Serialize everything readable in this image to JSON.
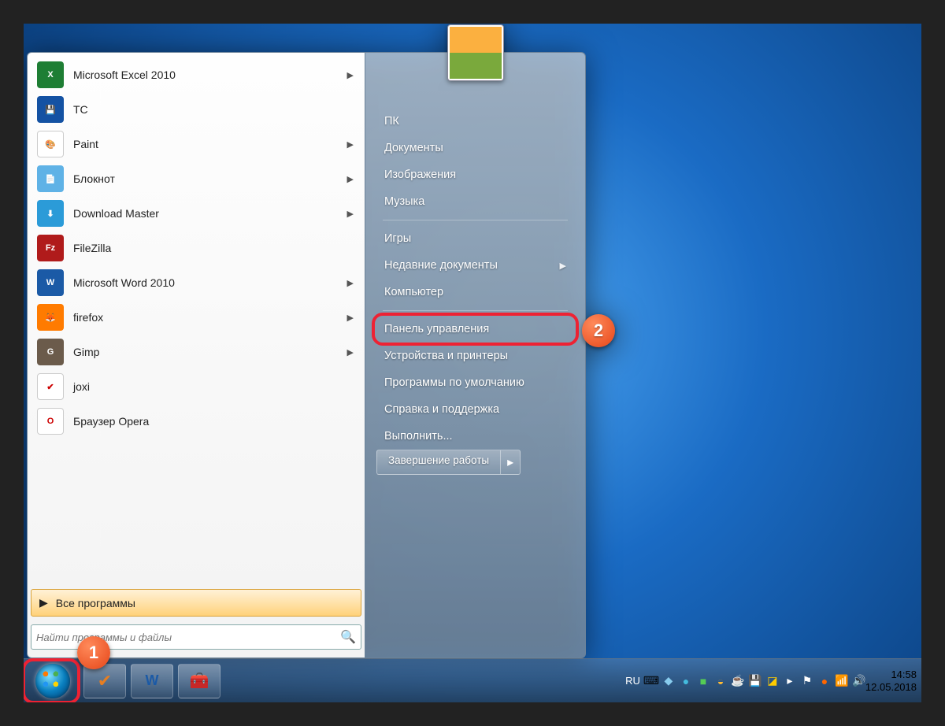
{
  "left_programs": [
    {
      "label": "Microsoft Excel 2010",
      "icon_bg": "#1e7e34",
      "icon_txt": "X",
      "arrow": true,
      "name": "excel"
    },
    {
      "label": "TC",
      "icon_bg": "#1452a3",
      "icon_txt": "💾",
      "arrow": false,
      "name": "tc"
    },
    {
      "label": "Paint",
      "icon_bg": "#fff",
      "icon_txt": "🎨",
      "arrow": true,
      "name": "paint"
    },
    {
      "label": "Блокнот",
      "icon_bg": "#5fb2e6",
      "icon_txt": "📄",
      "arrow": true,
      "name": "notepad"
    },
    {
      "label": "Download Master",
      "icon_bg": "#2b9bd8",
      "icon_txt": "⬇",
      "arrow": true,
      "name": "download-master"
    },
    {
      "label": "FileZilla",
      "icon_bg": "#b01b1b",
      "icon_txt": "Fz",
      "arrow": false,
      "name": "filezilla"
    },
    {
      "label": "Microsoft Word 2010",
      "icon_bg": "#1b5aa6",
      "icon_txt": "W",
      "arrow": true,
      "name": "word"
    },
    {
      "label": "firefox",
      "icon_bg": "#ff7b00",
      "icon_txt": "🦊",
      "arrow": true,
      "name": "firefox"
    },
    {
      "label": "Gimp",
      "icon_bg": "#6b5b4b",
      "icon_txt": "G",
      "arrow": true,
      "name": "gimp"
    },
    {
      "label": "joxi",
      "icon_bg": "#fff",
      "icon_txt": "✔",
      "arrow": false,
      "name": "joxi"
    },
    {
      "label": "Браузер Opera",
      "icon_bg": "#fff",
      "icon_txt": "O",
      "arrow": false,
      "name": "opera"
    }
  ],
  "all_programs_label": "Все программы",
  "search_placeholder": "Найти программы и файлы",
  "right_panel": {
    "items_top": [
      "ПК",
      "Документы",
      "Изображения",
      "Музыка"
    ],
    "items_mid": [
      {
        "label": "Игры",
        "arrow": false
      },
      {
        "label": "Недавние документы",
        "arrow": true
      },
      {
        "label": "Компьютер",
        "arrow": false
      }
    ],
    "items_bot": [
      {
        "label": "Панель управления",
        "highlight": true
      },
      {
        "label": "Устройства и принтеры",
        "highlight": false
      },
      {
        "label": "Программы по умолчанию",
        "highlight": false
      },
      {
        "label": "Справка и поддержка",
        "highlight": false
      },
      {
        "label": "Выполнить...",
        "highlight": false
      }
    ]
  },
  "shutdown_label": "Завершение работы",
  "taskbar": {
    "lang": "RU",
    "time": "14:58",
    "date": "12.05.2018"
  },
  "callouts": {
    "one": "1",
    "two": "2"
  }
}
